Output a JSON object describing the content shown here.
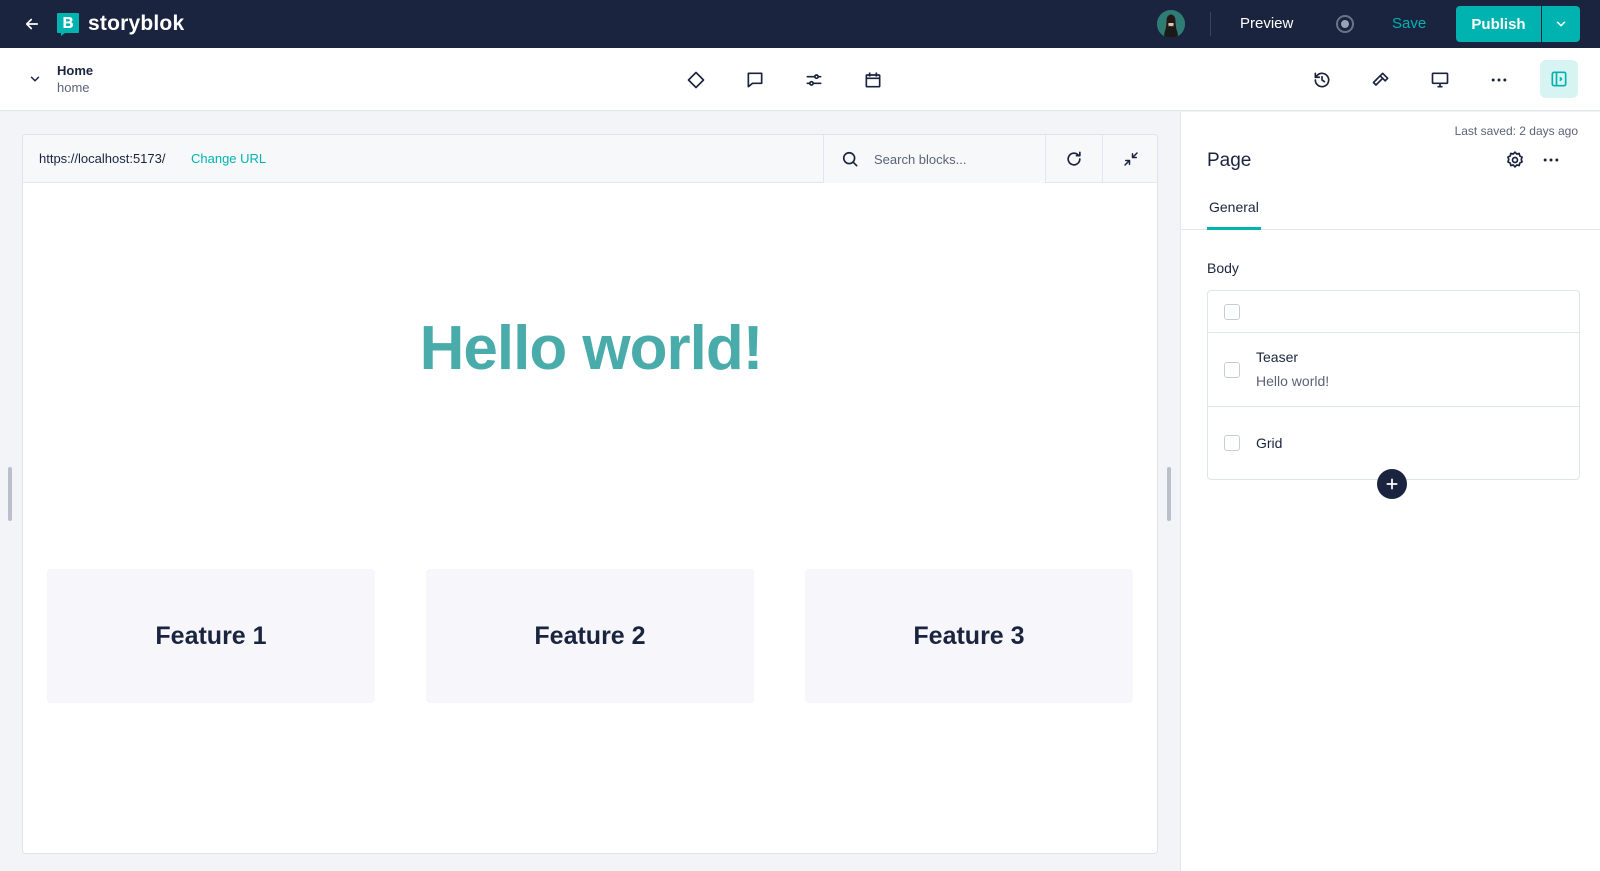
{
  "app": {
    "brand": "storyblok",
    "accent": "#00b3b0",
    "nav_bg": "#1b243f"
  },
  "topbar": {
    "preview_label": "Preview",
    "save_label": "Save",
    "publish_label": "Publish"
  },
  "story": {
    "title": "Home",
    "slug": "home"
  },
  "toolbar": {
    "icons": [
      "diamond-icon",
      "comment-icon",
      "sliders-icon",
      "calendar-icon",
      "history-icon",
      "hammer-icon",
      "monitor-icon",
      "more-icon",
      "panel-toggle-icon"
    ]
  },
  "preview": {
    "url": "https://localhost:5173/",
    "change_url_label": "Change URL",
    "search_placeholder": "Search blocks...",
    "hero_title": "Hello world!",
    "hero_color": "#4aabab",
    "features": [
      "Feature 1",
      "Feature 2",
      "Feature 3"
    ]
  },
  "panel": {
    "last_saved": "Last saved: 2 days ago",
    "title": "Page",
    "tabs": [
      "General"
    ],
    "field_label": "Body",
    "blocks": [
      {
        "name": "",
        "subtitle": ""
      },
      {
        "name": "Teaser",
        "subtitle": "Hello world!"
      },
      {
        "name": "Grid",
        "subtitle": ""
      }
    ]
  }
}
